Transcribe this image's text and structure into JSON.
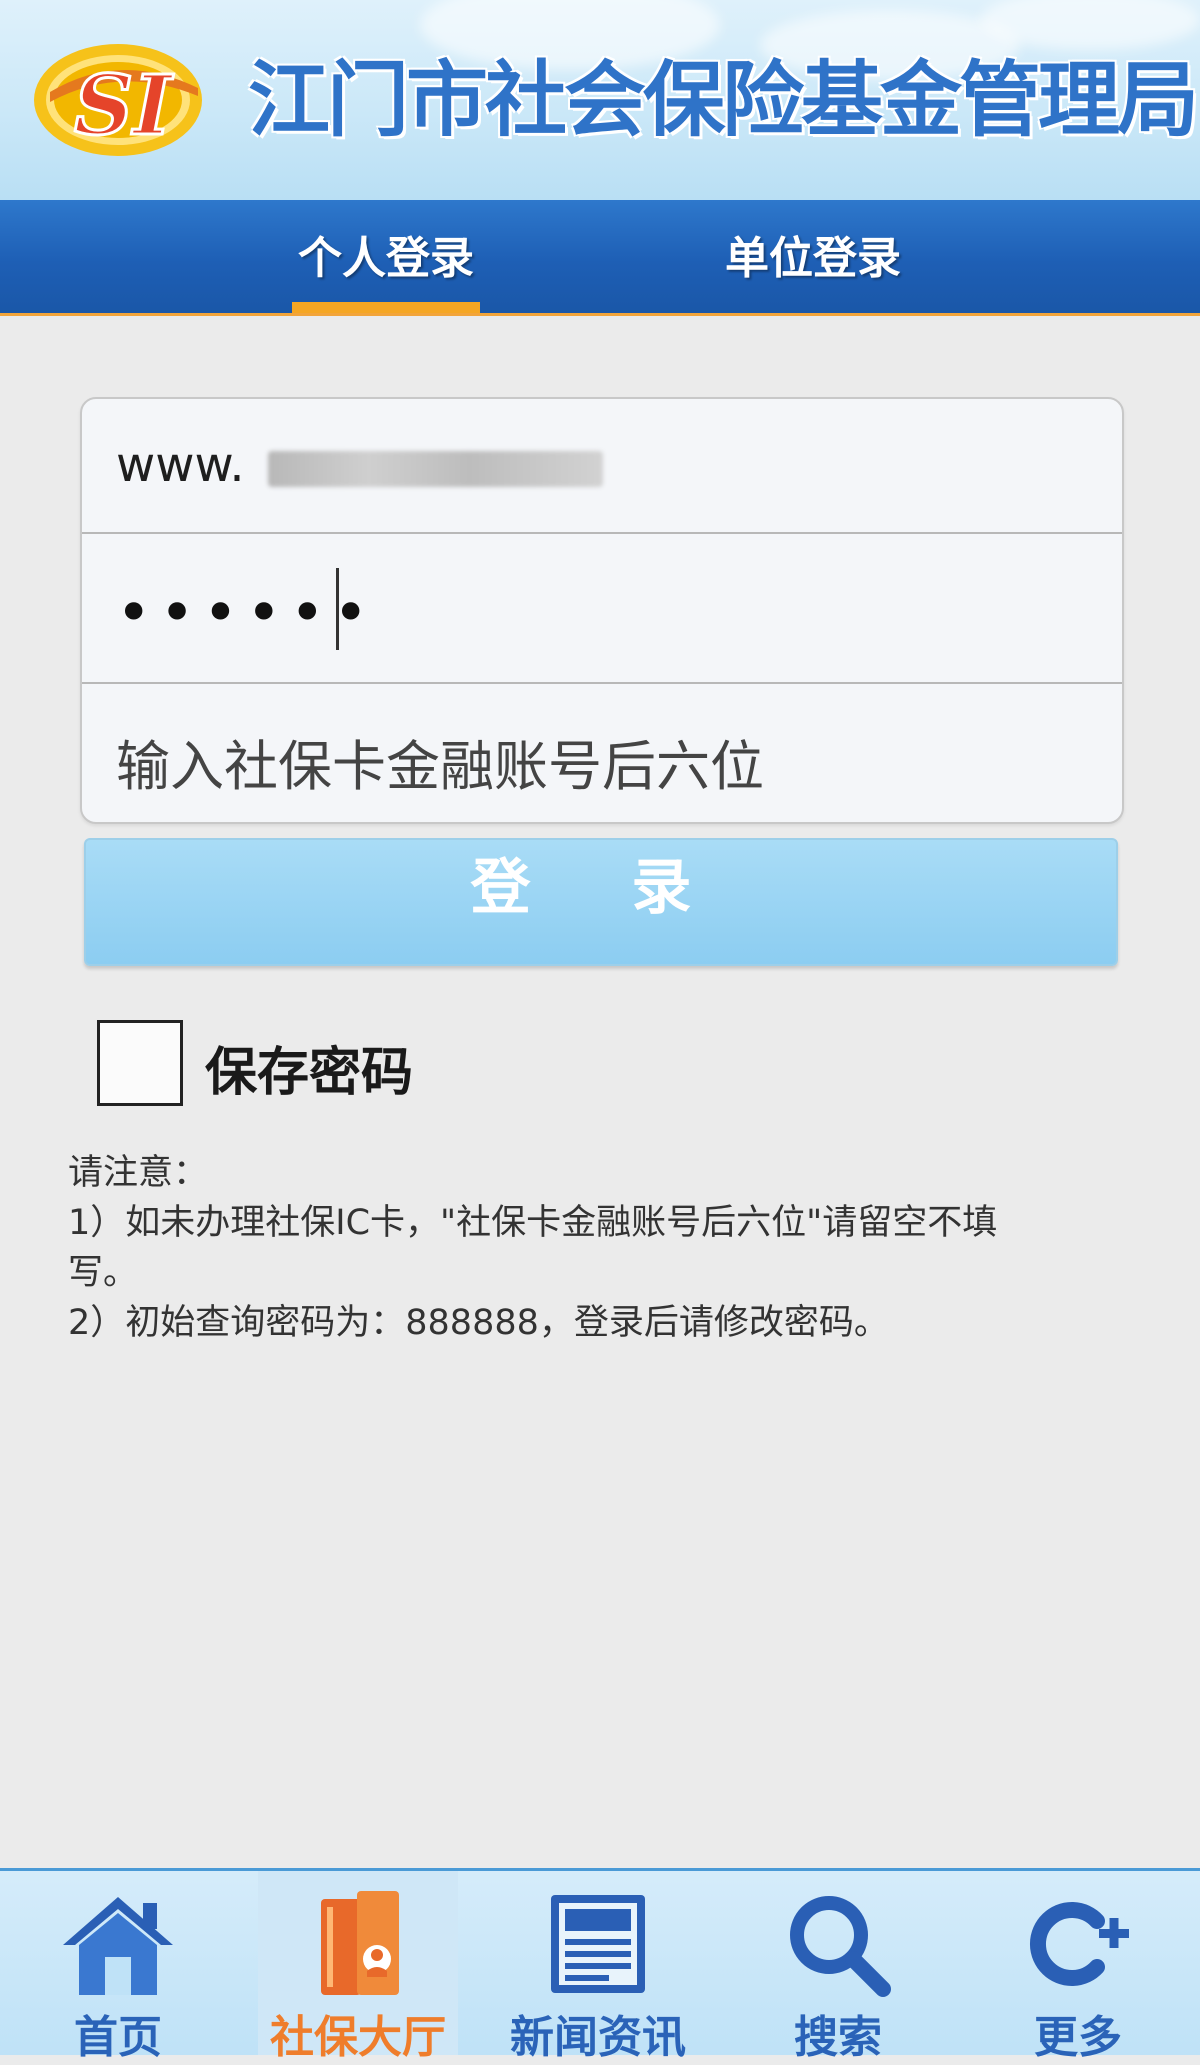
{
  "header": {
    "logo_text": "SI",
    "title": "江门市社会保险基金管理局"
  },
  "tabs": [
    {
      "label": "个人登录",
      "active": true
    },
    {
      "label": "单位登录",
      "active": false
    }
  ],
  "form": {
    "username_value": "www.",
    "password_value": "••••••",
    "card_placeholder": "输入社保卡金融账号后六位",
    "login_label": "登 录",
    "remember_label": "保存密码",
    "remember_checked": false
  },
  "notes": {
    "heading": "请注意：",
    "line1": "1）如未办理社保IC卡，\"社保卡金融账号后六位\"请留空不填",
    "line1_cont": "写。",
    "line2": "2）初始查询密码为：888888，登录后请修改密码。"
  },
  "bottom_nav": [
    {
      "label": "首页",
      "icon": "home-icon",
      "active": false
    },
    {
      "label": "社保大厅",
      "icon": "service-hall-icon",
      "active": true
    },
    {
      "label": "新闻资讯",
      "icon": "news-icon",
      "active": false
    },
    {
      "label": "搜索",
      "icon": "search-icon",
      "active": false
    },
    {
      "label": "更多",
      "icon": "more-icon",
      "active": false
    }
  ],
  "colors": {
    "header_blue": "#1e5fb5",
    "tab_underline": "#f5a623",
    "login_button": "#8ccdf1",
    "nav_label": "#2a63b8",
    "nav_active": "#ef7d2b"
  }
}
